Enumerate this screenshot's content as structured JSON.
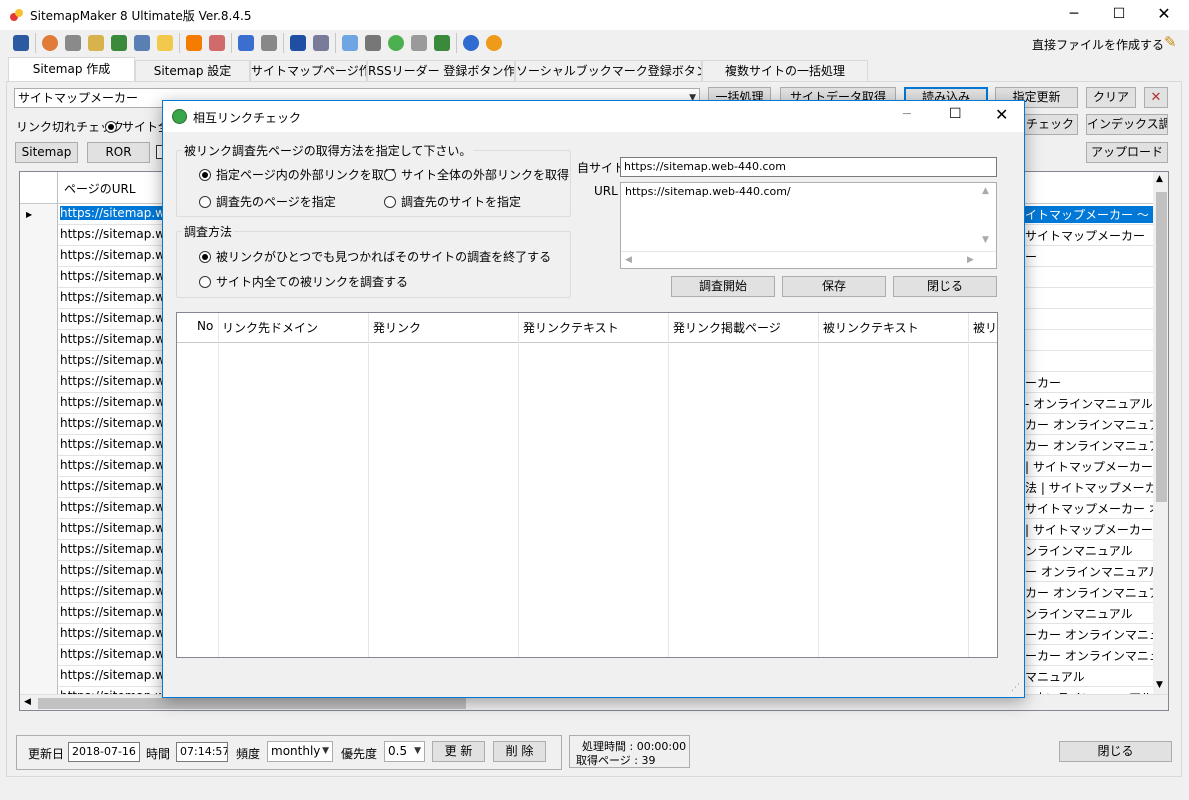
{
  "app": {
    "title": "SitemapMaker 8 Ultimate版  Ver.8.4.5",
    "direct_file": "直接ファイルを作成する"
  },
  "toolbar": {
    "icons": [
      "exit-icon",
      "open-globe-icon",
      "tools-icon",
      "folder-setting-icon",
      "sitemap-tree-icon",
      "monitor-icon",
      "folder-open-icon",
      "rss-icon",
      "pencil-tool-icon",
      "settings-tools-icon",
      "paypal-icon",
      "list-icon",
      "chat-icon",
      "printer-icon",
      "globe-check-icon",
      "link-chain-icon",
      "upload-icon",
      "help-icon",
      "info-icon"
    ]
  },
  "tabs": [
    "Sitemap 作成",
    "Sitemap 設定",
    "サイトマップページ作成",
    "RSSリーダー 登録ボタン作成",
    "ソーシャルブックマーク登録ボタン作成",
    "複数サイトの一括処理"
  ],
  "main": {
    "site_select": "サイトマップメーカー",
    "buttons_top": [
      "一括処理",
      "サイトデータ取得",
      "読み込み",
      "指定更新",
      "クリア"
    ],
    "linkcheck_label": "リンク切れチェック",
    "linkcheck_option": "サイト全",
    "buttons_right2": [
      "エチェック",
      "インデックス調査"
    ],
    "buttons_left": [
      "Sitemap",
      "ROR"
    ],
    "upload": "アップロード",
    "grid_header": "ページのURL",
    "url_prefix": "https://sitemap.web",
    "row_right": [
      "イトマップメーカー ～",
      "サイトマップメーカー",
      "ー",
      "",
      "",
      "",
      "",
      "",
      "ーカー",
      "- オンラインマニュアル",
      "カー オンラインマニュアル",
      "カー オンラインマニュアル",
      "| サイトマップメーカー オン",
      "法 | サイトマップメーカー",
      "サイトマップメーカー オンライン",
      "| サイトマップメーカー オン",
      "ンラインマニュアル",
      "ー オンラインマニュアル",
      "カー オンラインマニュアル",
      "ンラインマニュアル",
      "ーカー オンラインマニュアル",
      "ーカー オンラインマニュアル",
      "マニュアル",
      "- オンラインマニュアル"
    ]
  },
  "bottom": {
    "updated_label": "更新日",
    "updated_value": "2018-07-16",
    "time_label": "時間",
    "time_value": "07:14:57",
    "freq_label": "頻度",
    "freq_value": "monthly",
    "priority_label": "優先度",
    "priority_value": "0.5",
    "update_btn": "更 新",
    "delete_btn": "削 除",
    "proc_time": "処理時間 : 00:00:00",
    "pages": "取得ページ : 39",
    "close": "閉じる"
  },
  "dialog": {
    "title": "相互リンクチェック",
    "group1_title": "被リンク調査先ページの取得方法を指定して下さい。",
    "opt_page_external": "指定ページ内の外部リンクを取得",
    "opt_site_external": "サイト全体の外部リンクを取得",
    "opt_target_page": "調査先のページを指定",
    "opt_target_site": "調査先のサイトを指定",
    "group2_title": "調査方法",
    "opt_stop_first": "被リンクがひとつでも見つかればそのサイトの調査を終了する",
    "opt_all": "サイト内全ての被リンクを調査する",
    "own_site_label": "自サイト",
    "own_site_value": "https://sitemap.web-440.com",
    "url_label": "URL",
    "url_value": "https://sitemap.web-440.com/",
    "start_btn": "調査開始",
    "save_btn": "保存",
    "close_btn": "閉じる",
    "columns": [
      "No",
      "リンク先ドメイン",
      "発リンク",
      "発リンクテキスト",
      "発リンク掲載ページ",
      "被リンクテキスト",
      "被リン"
    ]
  }
}
